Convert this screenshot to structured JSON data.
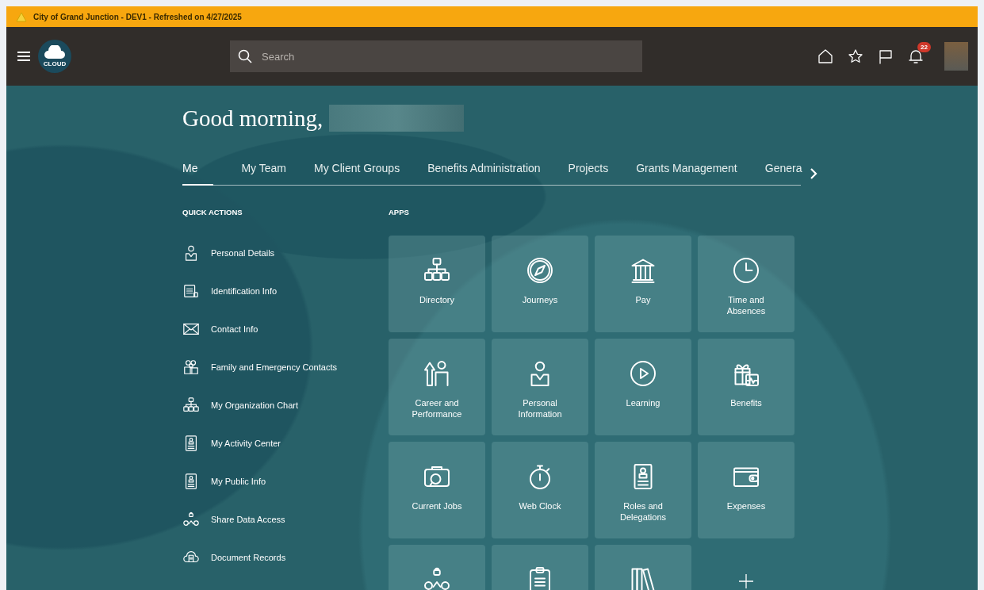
{
  "banner": {
    "text": "City of Grand Junction - DEV1 - Refreshed on 4/27/2025"
  },
  "header": {
    "logo_text": "CLOUD",
    "search": {
      "placeholder": "Search"
    },
    "notifications": "22"
  },
  "greeting": "Good morning,",
  "tabs": [
    {
      "label": "Me",
      "selected": true
    },
    {
      "label": "My Team",
      "selected": false
    },
    {
      "label": "My Client Groups",
      "selected": false
    },
    {
      "label": "Benefits Administration",
      "selected": false
    },
    {
      "label": "Projects",
      "selected": false
    },
    {
      "label": "Grants Management",
      "selected": false
    },
    {
      "label": "Genera",
      "selected": false
    }
  ],
  "quick_actions": {
    "title": "QUICK ACTIONS",
    "items": [
      {
        "label": "Personal Details"
      },
      {
        "label": "Identification Info"
      },
      {
        "label": "Contact Info"
      },
      {
        "label": "Family and Emergency Contacts"
      },
      {
        "label": "My Organization Chart"
      },
      {
        "label": "My Activity Center"
      },
      {
        "label": "My Public Info"
      },
      {
        "label": "Share Data Access"
      },
      {
        "label": "Document Records"
      }
    ]
  },
  "apps": {
    "title": "APPS",
    "items": [
      {
        "kind": "app",
        "label": "Directory"
      },
      {
        "kind": "app",
        "label": "Journeys"
      },
      {
        "kind": "app",
        "label": "Pay"
      },
      {
        "kind": "app",
        "label": "Time and Absences"
      },
      {
        "kind": "app",
        "label": "Career and Performance"
      },
      {
        "kind": "app",
        "label": "Personal Information"
      },
      {
        "kind": "app",
        "label": "Learning"
      },
      {
        "kind": "app",
        "label": "Benefits"
      },
      {
        "kind": "app",
        "label": "Current Jobs"
      },
      {
        "kind": "app",
        "label": "Web Clock"
      },
      {
        "kind": "app",
        "label": "Roles and Delegations"
      },
      {
        "kind": "app",
        "label": "Expenses"
      },
      {
        "kind": "app"
      },
      {
        "kind": "app"
      },
      {
        "kind": "app"
      },
      {
        "kind": "add"
      }
    ]
  }
}
